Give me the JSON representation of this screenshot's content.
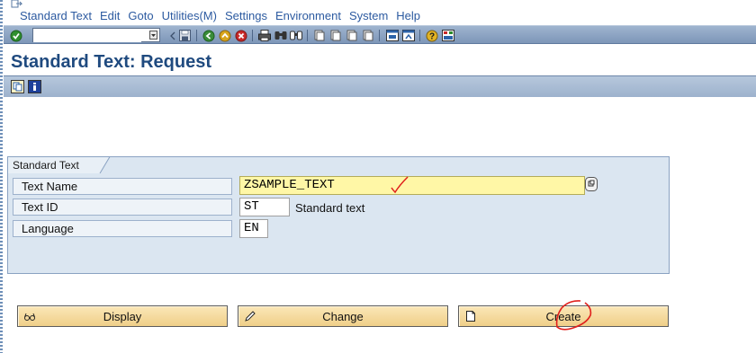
{
  "menu": {
    "items": [
      {
        "label": "Standard Text"
      },
      {
        "label": "Edit"
      },
      {
        "label": "Goto"
      },
      {
        "label": "Utilities(M)"
      },
      {
        "label": "Settings"
      },
      {
        "label": "Environment"
      },
      {
        "label": "System"
      },
      {
        "label": "Help"
      }
    ]
  },
  "toolbar": {
    "command_value": "",
    "icons": [
      "enter-icon",
      "save-icon",
      "back-icon",
      "exit-icon",
      "cancel-icon",
      "print-icon",
      "find-icon",
      "find-next-icon",
      "first-page-icon",
      "previous-page-icon",
      "next-page-icon",
      "last-page-icon",
      "create-session-icon",
      "shortcut-icon",
      "help-icon",
      "layout-icon"
    ]
  },
  "title": "Standard Text: Request",
  "app_toolbar": {
    "icons": [
      "copy-icon",
      "info-icon"
    ]
  },
  "group": {
    "title": "Standard Text",
    "fields": {
      "text_name": {
        "label": "Text Name",
        "value": "ZSAMPLE_TEXT"
      },
      "text_id": {
        "label": "Text ID",
        "value": "ST",
        "description": "Standard text"
      },
      "language": {
        "label": "Language",
        "value": "EN"
      }
    }
  },
  "buttons": {
    "display": "Display",
    "change": "Change",
    "create": "Create"
  },
  "colors": {
    "title": "#1f4a7f",
    "menu_text": "#2c5aa0",
    "required_field": "#fff7a6",
    "group_background": "#dbe6f1",
    "button": "#f3d99b",
    "annotation": "#e0201c"
  }
}
